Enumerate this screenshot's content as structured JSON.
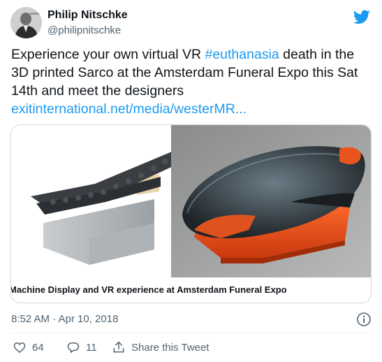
{
  "author": {
    "name": "Philip Nitschke",
    "handle": "@philipnitschke"
  },
  "tweet": {
    "text_before_hashtag": "Experience your own virtual VR ",
    "hashtag": "#euthanasia",
    "text_after_hashtag": " death in the 3D printed Sarco at the Amsterdam Funeral Expo this Sat 14th and meet the designers",
    "link": "exitinternational.net/media/westerMR..."
  },
  "card": {
    "title": "Machine Display and VR experience at Amsterdam Funeral Expo"
  },
  "meta": {
    "timestamp": "8:52 AM · Apr 10, 2018"
  },
  "actions": {
    "likes": "64",
    "replies": "11",
    "share_label": "Share this Tweet"
  },
  "colors": {
    "accent": "#1d9bf0",
    "text_secondary": "#536471",
    "border": "#cfd9de",
    "capsule_orange": "#e8541e"
  },
  "icons": {
    "brand": "twitter-bird-icon",
    "info": "info-icon",
    "like": "heart-icon",
    "reply": "reply-bubble-icon",
    "share": "share-upload-icon"
  }
}
